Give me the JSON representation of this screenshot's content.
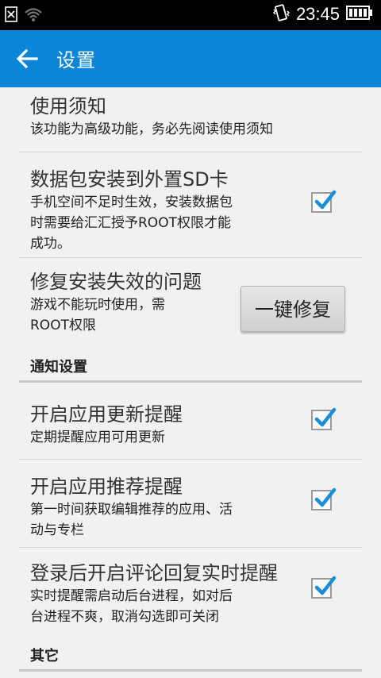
{
  "statusbar": {
    "time": "23:45",
    "icons": [
      "sim-x-icon",
      "wifi-icon",
      "vibrate-icon",
      "battery-icon"
    ]
  },
  "appbar": {
    "title": "设置",
    "back_icon": "back-arrow-icon",
    "color": "#0a85d8"
  },
  "items": [
    {
      "title": "使用须知",
      "desc": [
        "该功能为高级功能，务必先阅读使用须知"
      ]
    },
    {
      "title": "数据包安装到外置SD卡",
      "desc": [
        "手机空间不足时生效，安装数据包",
        "时需要给汇汇授予ROOT权限才能",
        "成功。"
      ],
      "checked": true
    },
    {
      "title": "修复安装失效的问题",
      "desc": [
        "游戏不能玩时使用，需",
        "ROOT权限"
      ],
      "button": "一键修复"
    }
  ],
  "notify_section": {
    "header": "通知设置",
    "items": [
      {
        "title": "开启应用更新提醒",
        "desc": [
          "定期提醒应用可用更新"
        ],
        "checked": true
      },
      {
        "title": "开启应用推荐提醒",
        "desc": [
          "第一时间获取编辑推荐的应用、活",
          "动与专栏"
        ],
        "checked": true
      },
      {
        "title": "登录后开启评论回复实时提醒",
        "desc": [
          "实时提醒需启动后台进程，如对后",
          "台进程不爽，取消勾选即可关闭"
        ],
        "checked": true
      }
    ]
  },
  "other_section": {
    "header": "其它"
  }
}
